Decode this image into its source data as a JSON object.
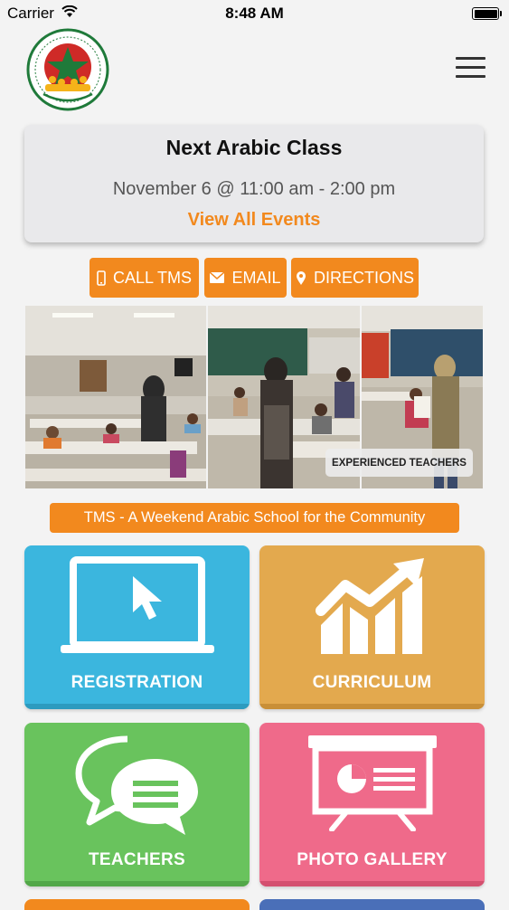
{
  "status_bar": {
    "carrier": "Carrier",
    "time": "8:48 AM"
  },
  "header": {
    "logo_icon": "school-crest-logo",
    "menu_icon": "hamburger-menu-icon"
  },
  "event": {
    "title": "Next Arabic Class",
    "time": "November 6 @ 11:00 am - 2:00 pm",
    "link": "View All Events"
  },
  "actions": [
    {
      "label": "CALL TMS",
      "icon": "phone-icon"
    },
    {
      "label": "EMAIL",
      "icon": "envelope-icon"
    },
    {
      "label": "DIRECTIONS",
      "icon": "map-pin-icon"
    }
  ],
  "gallery": {
    "caption": "EXPERIENCED TEACHERS"
  },
  "tagline": "TMS - A Weekend Arabic School for the Community",
  "tiles": [
    {
      "label": "REGISTRATION",
      "icon": "laptop-cursor-icon",
      "color": "#3bb6de"
    },
    {
      "label": "CURRICULUM",
      "icon": "growth-chart-icon",
      "color": "#e3a94e"
    },
    {
      "label": "TEACHERS",
      "icon": "chat-bubbles-icon",
      "color": "#69c35d"
    },
    {
      "label": "PHOTO GALLERY",
      "icon": "presentation-board-icon",
      "color": "#ef6a8a"
    }
  ],
  "colors": {
    "accent": "#f2891e",
    "background": "#f3f3f3"
  }
}
